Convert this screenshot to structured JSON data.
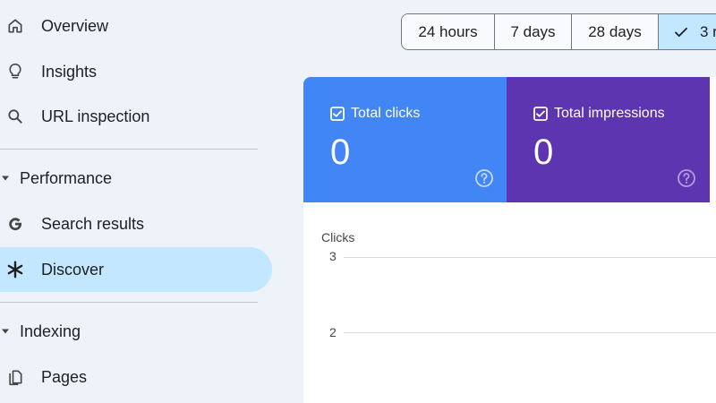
{
  "sidebar": {
    "items": [
      {
        "label": "Overview",
        "icon": "home-icon"
      },
      {
        "label": "Insights",
        "icon": "lightbulb-icon"
      },
      {
        "label": "URL inspection",
        "icon": "search-icon"
      }
    ],
    "sections": [
      {
        "label": "Performance",
        "items": [
          {
            "label": "Search results",
            "icon": "google-g-icon"
          },
          {
            "label": "Discover",
            "icon": "discover-asterisk-icon",
            "active": true
          }
        ]
      },
      {
        "label": "Indexing",
        "items": [
          {
            "label": "Pages",
            "icon": "pages-icon"
          }
        ]
      }
    ]
  },
  "date_range": {
    "options": [
      "24 hours",
      "7 days",
      "28 days",
      "3 r"
    ],
    "selected": "3 r"
  },
  "metrics": {
    "clicks": {
      "label": "Total clicks",
      "value": "0",
      "color": "#4285f4",
      "checked": true
    },
    "impressions": {
      "label": "Total impressions",
      "value": "0",
      "color": "#5e35b1",
      "checked": true
    }
  },
  "chart_data": {
    "type": "line",
    "ylabel": "Clicks",
    "y_ticks": [
      "3",
      "2"
    ],
    "series": []
  },
  "colors": {
    "background": "#eef3f9",
    "active_nav": "#c2e7ff",
    "selected_range": "#c2e7ff"
  }
}
